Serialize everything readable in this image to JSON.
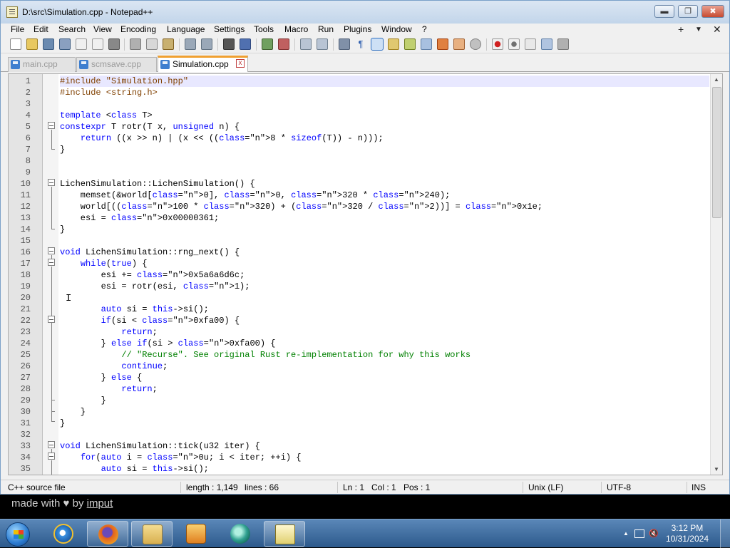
{
  "window": {
    "title": "D:\\src\\Simulation.cpp - Notepad++",
    "minimize": "▬",
    "restore": "❐",
    "close": "✖"
  },
  "menu": [
    "File",
    "Edit",
    "Search",
    "View",
    "Encoding",
    "Language",
    "Settings",
    "Tools",
    "Macro",
    "Run",
    "Plugins",
    "Window",
    "?"
  ],
  "menu_right": {
    "plus": "+",
    "down": "▼",
    "close": "✕"
  },
  "tabs": [
    {
      "label": "main.cpp"
    },
    {
      "label": "scmsave.cpp"
    },
    {
      "label": "Simulation.cpp"
    }
  ],
  "tab_close": "x",
  "editor": {
    "caret_glyph": "I",
    "lines": [
      {
        "n": "1",
        "text": "#include \"Simulation.hpp\""
      },
      {
        "n": "2",
        "text": "#include <string.h>"
      },
      {
        "n": "3",
        "text": ""
      },
      {
        "n": "4",
        "text": "template <class T>"
      },
      {
        "n": "5",
        "text": "constexpr T rotr(T x, unsigned n) {"
      },
      {
        "n": "6",
        "text": "    return ((x >> n) | (x << ((8 * sizeof(T)) - n)));"
      },
      {
        "n": "7",
        "text": "}"
      },
      {
        "n": "8",
        "text": ""
      },
      {
        "n": "9",
        "text": ""
      },
      {
        "n": "10",
        "text": "LichenSimulation::LichenSimulation() {"
      },
      {
        "n": "11",
        "text": "    memset(&world[0], 0, 320 * 240);"
      },
      {
        "n": "12",
        "text": "    world[((100 * 320) + (320 / 2))] = 0x1e;"
      },
      {
        "n": "13",
        "text": "    esi = 0x00000361;"
      },
      {
        "n": "14",
        "text": "}"
      },
      {
        "n": "15",
        "text": ""
      },
      {
        "n": "16",
        "text": "void LichenSimulation::rng_next() {"
      },
      {
        "n": "17",
        "text": "    while(true) {"
      },
      {
        "n": "18",
        "text": "        esi += 0x5a6a6d6c;"
      },
      {
        "n": "19",
        "text": "        esi = rotr(esi, 1);"
      },
      {
        "n": "20",
        "text": ""
      },
      {
        "n": "21",
        "text": "        auto si = this->si();"
      },
      {
        "n": "22",
        "text": "        if(si < 0xfa00) {"
      },
      {
        "n": "23",
        "text": "            return;"
      },
      {
        "n": "24",
        "text": "        } else if(si > 0xfa00) {"
      },
      {
        "n": "25",
        "text": "            // \"Recurse\". See original Rust re-implementation for why this works"
      },
      {
        "n": "26",
        "text": "            continue;"
      },
      {
        "n": "27",
        "text": "        } else {"
      },
      {
        "n": "28",
        "text": "            return;"
      },
      {
        "n": "29",
        "text": "        }"
      },
      {
        "n": "30",
        "text": "    }"
      },
      {
        "n": "31",
        "text": "}"
      },
      {
        "n": "32",
        "text": ""
      },
      {
        "n": "33",
        "text": "void LichenSimulation::tick(u32 iter) {"
      },
      {
        "n": "34",
        "text": "    for(auto i = 0u; i < iter; ++i) {"
      },
      {
        "n": "35",
        "text": "        auto si = this->si();"
      }
    ]
  },
  "status": {
    "file_type": "C++ source file",
    "length": "length : 1,149",
    "lines": "lines : 66",
    "ln": "Ln : 1",
    "col": "Col : 1",
    "pos": "Pos : 1",
    "eol": "Unix (LF)",
    "encoding": "UTF-8",
    "mode": "INS"
  },
  "background": {
    "made_with": "made with",
    "heart": "♥",
    "by": "by",
    "author": "imput"
  },
  "taskbar": {
    "time": "3:12 PM",
    "date": "10/31/2024",
    "tray_up": "▲",
    "volume_muted": "🔇"
  },
  "colors": {
    "keyword": "#0000ff",
    "type": "#8000ff",
    "number": "#ff8000",
    "string": "#808080",
    "comment": "#008000",
    "current_line": "#e8e8ff"
  }
}
